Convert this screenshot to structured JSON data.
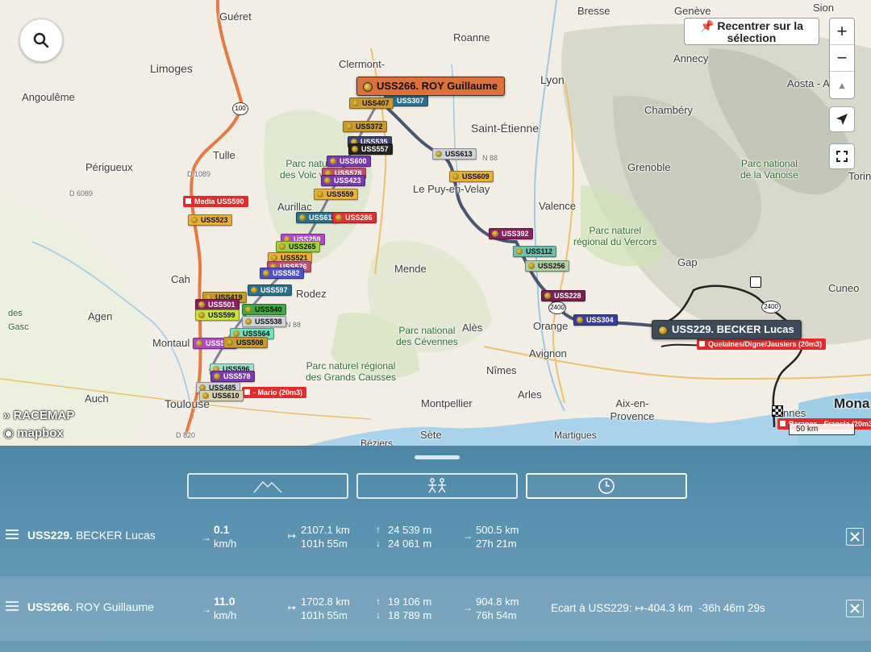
{
  "map": {
    "search_icon": "search-icon",
    "recenter_label": "Recentrer sur la sélection",
    "recenter_icon": "pin-icon",
    "zoom_in": "+",
    "zoom_out": "−",
    "compass": "▲",
    "locate_icon": "locate-arrow-icon",
    "fullscreen_icon": "fullscreen-icon",
    "brand_racemap": "RACEMAP",
    "brand_mapbox": "mapbox",
    "scale_label": "50 km",
    "places": [
      {
        "id": "gueret",
        "name": "Guéret"
      },
      {
        "id": "limoges",
        "name": "Limoges"
      },
      {
        "id": "angouleme",
        "name": "Angoulême"
      },
      {
        "id": "tulle",
        "name": "Tulle"
      },
      {
        "id": "perigueux",
        "name": "Périgueux"
      },
      {
        "id": "aurillac",
        "name": "Aurillac"
      },
      {
        "id": "cahors",
        "name": "Cah"
      },
      {
        "id": "agen",
        "name": "Agen"
      },
      {
        "id": "montauban",
        "name": "Montaul"
      },
      {
        "id": "auch",
        "name": "Auch"
      },
      {
        "id": "toulouse",
        "name": "Toulouse"
      },
      {
        "id": "clermont",
        "name": "Clermont-"
      },
      {
        "id": "roanne",
        "name": "Roanne"
      },
      {
        "id": "lyon",
        "name": "Lyon"
      },
      {
        "id": "saint_etienne",
        "name": "Saint-Étienne"
      },
      {
        "id": "le_puy",
        "name": "Le Puy-en-Velay"
      },
      {
        "id": "valence",
        "name": "Valence"
      },
      {
        "id": "mende",
        "name": "Mende"
      },
      {
        "id": "rodez",
        "name": "Rodez"
      },
      {
        "id": "ales",
        "name": "Alès"
      },
      {
        "id": "orange",
        "name": "Orange"
      },
      {
        "id": "avignon",
        "name": "Avignon"
      },
      {
        "id": "nimes",
        "name": "Nîmes"
      },
      {
        "id": "arles",
        "name": "Arles"
      },
      {
        "id": "montpellier",
        "name": "Montpellier"
      },
      {
        "id": "aix",
        "name": "Aix-en-Provence"
      },
      {
        "id": "sete",
        "name": "Sète"
      },
      {
        "id": "martigues",
        "name": "Martigues"
      },
      {
        "id": "beziers",
        "name": "Béziers"
      },
      {
        "id": "grenoble",
        "name": "Grenoble"
      },
      {
        "id": "chambery",
        "name": "Chambéry"
      },
      {
        "id": "annecy",
        "name": "Annecy"
      },
      {
        "id": "geneve",
        "name": "Genève"
      },
      {
        "id": "aosta",
        "name": "Aosta - A"
      },
      {
        "id": "gap",
        "name": "Gap"
      },
      {
        "id": "cuneo",
        "name": "Cuneo"
      },
      {
        "id": "bresse",
        "name": "Bresse"
      },
      {
        "id": "sion",
        "name": "Sion"
      },
      {
        "id": "monaco",
        "name": "Mona"
      },
      {
        "id": "cannes",
        "name": "nnes"
      },
      {
        "id": "torino",
        "name": "Torin"
      },
      {
        "id": "d1089",
        "name": "D 1089"
      },
      {
        "id": "d6089",
        "name": "D 6089"
      },
      {
        "id": "d820",
        "name": "D 820"
      },
      {
        "id": "n88a",
        "name": "N 88"
      },
      {
        "id": "n88b",
        "name": "N 88"
      }
    ],
    "parks": [
      {
        "id": "volcans",
        "name": "Parc naturel régional des Volcans d'Auvergne",
        "l1": "Parc natu   nal",
        "l2": "des Volc    vergne"
      },
      {
        "id": "vercors",
        "name": "Parc naturel régional du Vercors",
        "l1": "Parc naturel",
        "l2": "régional du Vercors"
      },
      {
        "id": "cevennes",
        "name": "Parc national des Cévennes",
        "l1": "Parc national",
        "l2": "des Cévennes"
      },
      {
        "id": "causses",
        "name": "Parc naturel régional des Grands Causses",
        "l1": "Parc naturel régional",
        "l2": "des Grands Causses"
      },
      {
        "id": "vanoise",
        "name": "Parc national de la Vanoise",
        "l1": "Parc national",
        "l2": "de la Vanoise"
      }
    ],
    "highlight_riders": [
      {
        "id": "uss266",
        "label": "USS266. ROY Guillaume",
        "color": "#e0703a"
      },
      {
        "id": "uss229",
        "label": "USS229. BECKER Lucas",
        "color": "#3d4a5c"
      }
    ],
    "rider_tags": [
      {
        "label": "USS307",
        "color": "#2b6f8f"
      },
      {
        "label": "USS407",
        "color": "#c99a2e"
      },
      {
        "label": "USS372",
        "color": "#c99a2e"
      },
      {
        "label": "USS535",
        "color": "#3b3f78"
      },
      {
        "label": "USS557",
        "color": "#222222"
      },
      {
        "label": "USS613",
        "color": "#cfd3d8"
      },
      {
        "label": "USS600",
        "color": "#7a3ab0"
      },
      {
        "label": "USS578",
        "color": "#c05070"
      },
      {
        "label": "USS423",
        "color": "#7a3ab0"
      },
      {
        "label": "USS609",
        "color": "#e8b03a"
      },
      {
        "label": "USS559",
        "color": "#e8b03a"
      },
      {
        "label": "USS611",
        "color": "#2b6f8f"
      },
      {
        "label": "USS286",
        "color": "#e03030"
      },
      {
        "label": "USS523",
        "color": "#e8b03a"
      },
      {
        "label": "USS259",
        "color": "#b048c8"
      },
      {
        "label": "USS265",
        "color": "#a0d040"
      },
      {
        "label": "USS521",
        "color": "#e8b03a"
      },
      {
        "label": "USS576",
        "color": "#c05070"
      },
      {
        "label": "USS582",
        "color": "#5050c8"
      },
      {
        "label": "USS597",
        "color": "#2b6f8f"
      },
      {
        "label": "USS392",
        "color": "#8a2060"
      },
      {
        "label": "USS112",
        "color": "#70c0b0"
      },
      {
        "label": "USS256",
        "color": "#b0d0a0"
      },
      {
        "label": "USS228",
        "color": "#7a2050"
      },
      {
        "label": "USS304",
        "color": "#3b3f9a"
      },
      {
        "label": "USS419",
        "color": "#c99a2e"
      },
      {
        "label": "USS501",
        "color": "#8a2060"
      },
      {
        "label": "USS599",
        "color": "#c8e040"
      },
      {
        "label": "USS540",
        "color": "#40a840"
      },
      {
        "label": "USS538",
        "color": "#cfd3d8"
      },
      {
        "label": "USS564",
        "color": "#70e0c0"
      },
      {
        "label": "USS575",
        "color": "#b048c8"
      },
      {
        "label": "USS508",
        "color": "#c99a2e"
      },
      {
        "label": "USS596",
        "color": "#a0e0d0"
      },
      {
        "label": "USS578",
        "color": "#7a3ab0"
      },
      {
        "label": "USS485",
        "color": "#cfd3d8"
      },
      {
        "label": "USS610",
        "color": "#d8d0b0"
      }
    ],
    "checkpoints": [
      {
        "id": "media",
        "label": "Media USS590"
      },
      {
        "id": "queyras",
        "label": "Quelaines/Digne/Jausiers (20m3)"
      },
      {
        "id": "mario",
        "label": "- Mario (20m3)"
      },
      {
        "id": "finish",
        "label": "Baranes - Francia (20m3)"
      }
    ],
    "road_shields": [
      "100",
      "2400",
      "2400"
    ],
    "colors": {
      "track": "#2e3a5e",
      "road": "#e47b40",
      "water": "#a9d3ea",
      "park": "#cfe3b5",
      "panel": "#4f88a7"
    }
  },
  "panel": {
    "modes": [
      {
        "id": "elevation",
        "icon": "mountain-icon",
        "active": false
      },
      {
        "id": "riders",
        "icon": "riders-icon",
        "active": false
      },
      {
        "id": "time",
        "icon": "clock-icon",
        "active": true
      }
    ],
    "rows": [
      {
        "bib": "USS229.",
        "name": "BECKER Lucas",
        "speed": "0.1",
        "speed_unit": "km/h",
        "distance": "2107.1 km",
        "distance_time": "101h 55m",
        "ascent": "24 539 m",
        "descent": "24 061 m",
        "remaining": "500.5 km",
        "remaining_time": "27h 21m",
        "gap_label": "",
        "gap_distance": "",
        "gap_time": ""
      },
      {
        "bib": "USS266.",
        "name": "ROY Guillaume",
        "speed": "11.0",
        "speed_unit": "km/h",
        "distance": "1702.8 km",
        "distance_time": "101h 55m",
        "ascent": "19 106 m",
        "descent": "18 789 m",
        "remaining": "904.8 km",
        "remaining_time": "76h 54m",
        "gap_label": "Ecart à USS229:",
        "gap_distance": "-404.3 km",
        "gap_time": "-36h 46m 29s"
      }
    ]
  }
}
